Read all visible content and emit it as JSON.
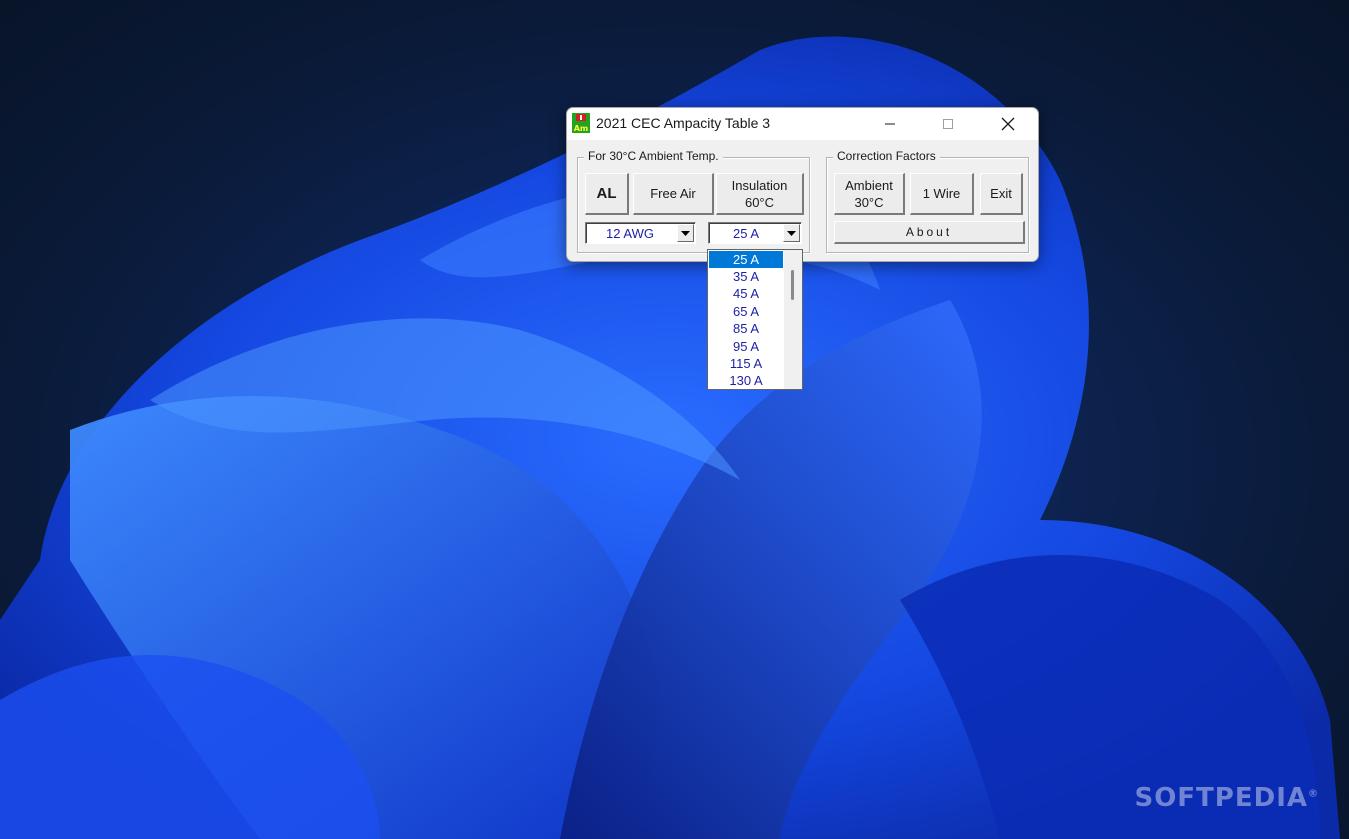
{
  "window": {
    "title": "2021 CEC Ampacity Table 3",
    "icon_letters": "Am",
    "icon_colors": {
      "flag": "#d42020",
      "background": "#22a422",
      "text": "#ffff33"
    }
  },
  "ambient_group": {
    "label": "For 30°C Ambient Temp.",
    "al_button": "AL",
    "free_air_button": "Free Air",
    "insulation_button": "Insulation\n60°C",
    "wire_size_value": "12 AWG",
    "ampacity_value": "25 A"
  },
  "correction_group": {
    "label": "Correction Factors",
    "ambient_button": "Ambient\n30°C",
    "one_wire_button": "1 Wire",
    "exit_button": "Exit",
    "about_button": "About"
  },
  "ampacity_dropdown": {
    "options": [
      "25 A",
      "35 A",
      "45 A",
      "65 A",
      "85 A",
      "95 A",
      "115 A",
      "130 A"
    ],
    "selected_index": 0
  },
  "watermark": {
    "text": "SOFTPEDIA",
    "mark": "®"
  },
  "colors": {
    "accent": "#0078d7",
    "value_text": "#1e1ea8",
    "window_bg": "#f0f0f0"
  }
}
